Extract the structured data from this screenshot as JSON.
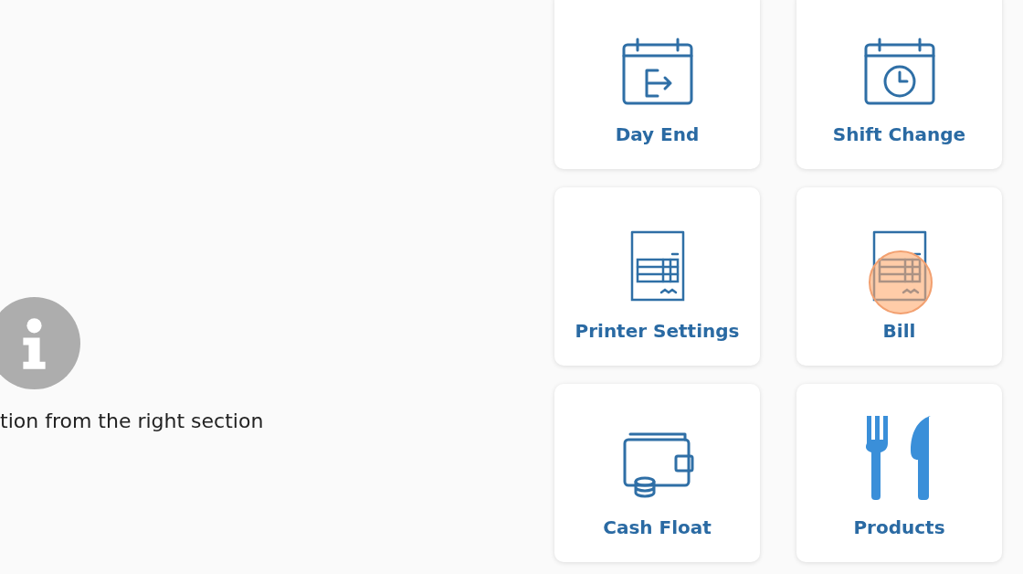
{
  "message": {
    "text": "tion from the right section"
  },
  "tiles": [
    {
      "label": "Day End"
    },
    {
      "label": "Shift Change"
    },
    {
      "label": "Printer Settings"
    },
    {
      "label": "Bill"
    },
    {
      "label": "Cash Float"
    },
    {
      "label": "Products"
    }
  ]
}
